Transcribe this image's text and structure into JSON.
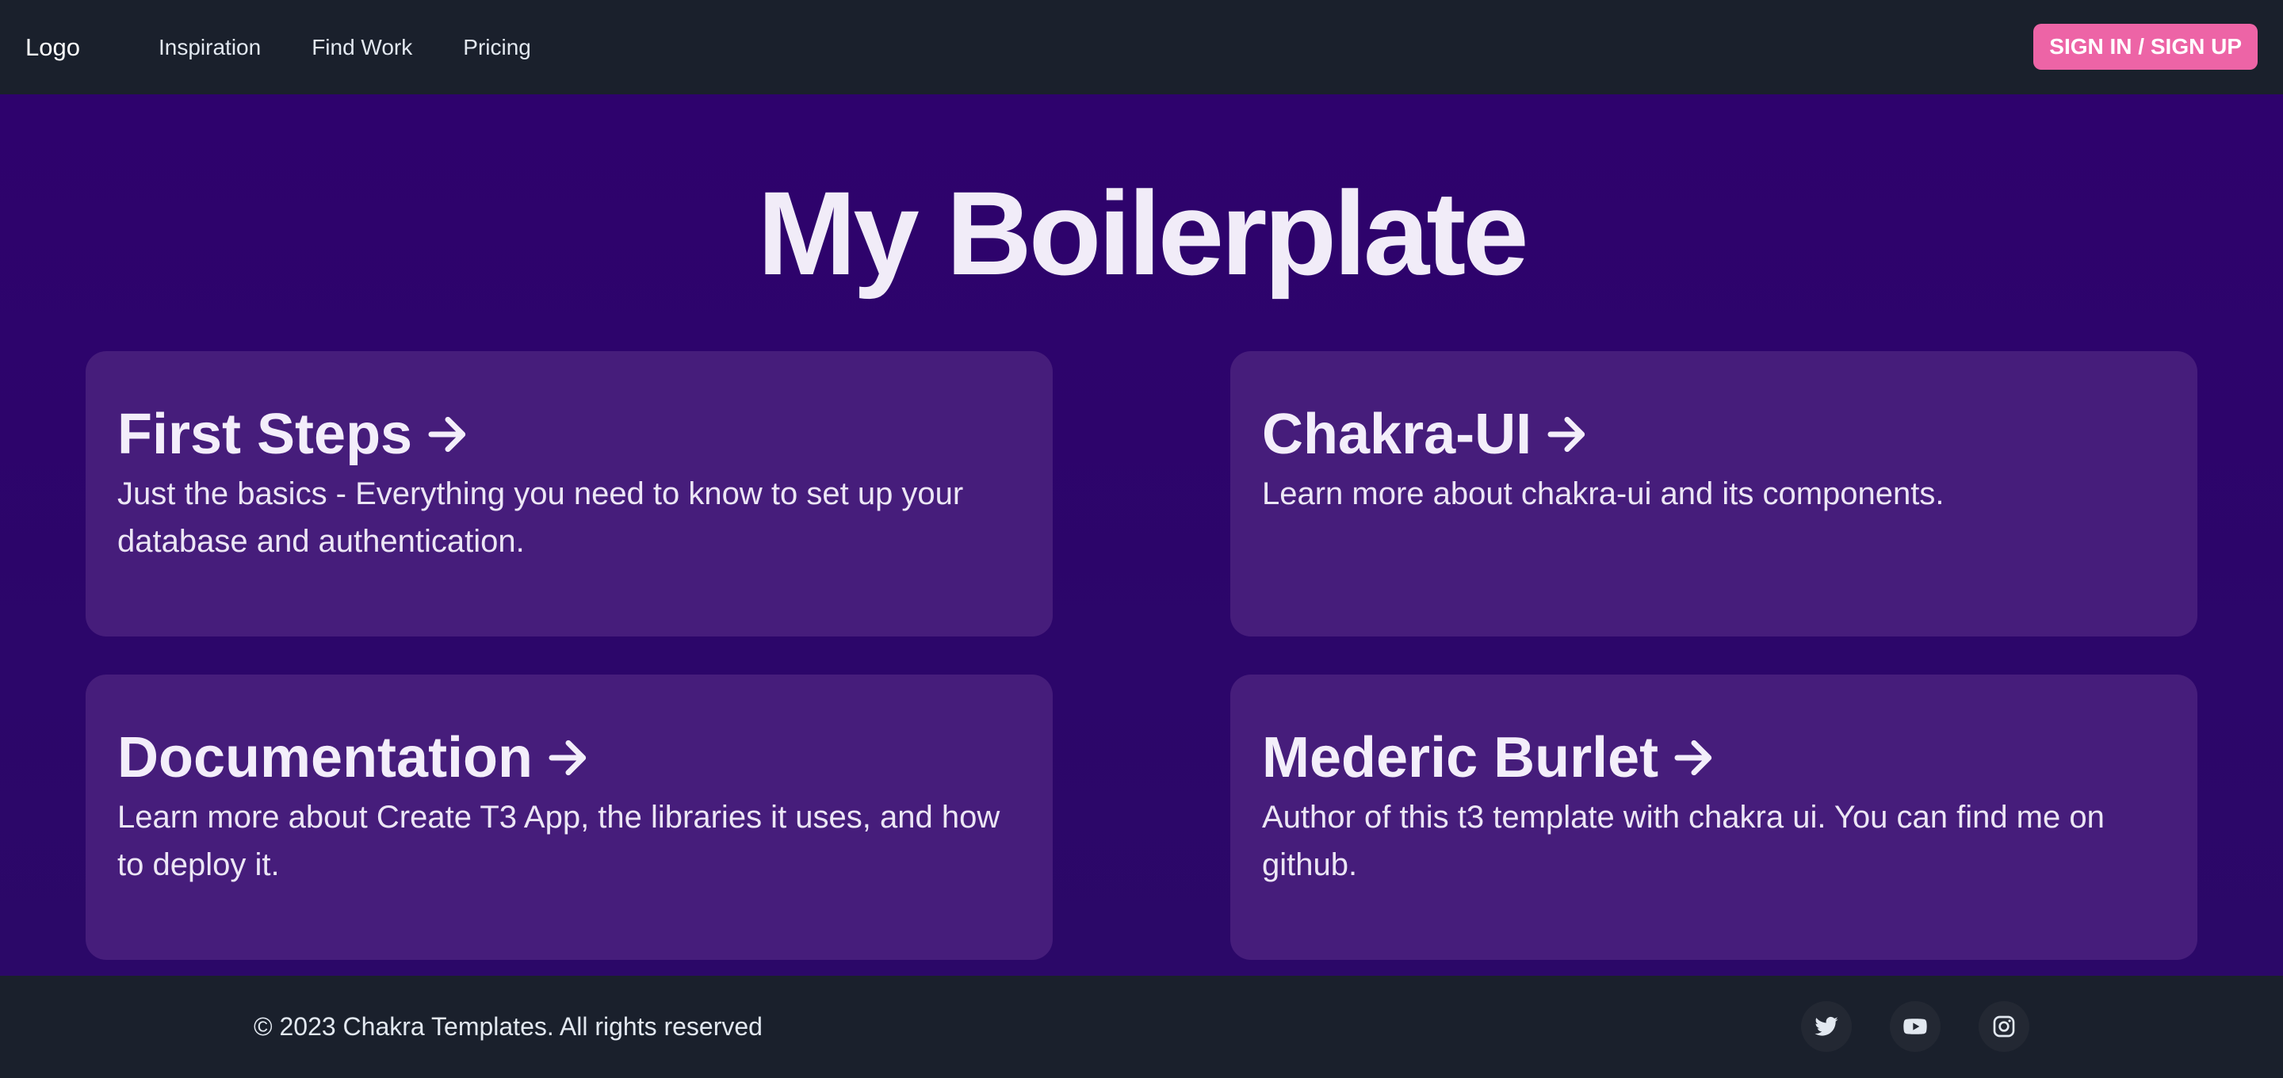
{
  "navbar": {
    "logo": "Logo",
    "links": [
      "Inspiration",
      "Find Work",
      "Pricing"
    ],
    "signin_label": "SIGN IN / SIGN UP"
  },
  "hero": {
    "title": "My Boilerplate"
  },
  "cards": [
    {
      "title": "First Steps",
      "description": "Just the basics - Everything you need to know to set up your database and authentication."
    },
    {
      "title": "Chakra-UI",
      "description": "Learn more about chakra-ui and its components."
    },
    {
      "title": "Documentation",
      "description": "Learn more about Create T3 App, the libraries it uses, and how to deploy it."
    },
    {
      "title": "Mederic Burlet",
      "description": "Author of this t3 template with chakra ui. You can find me on github."
    }
  ],
  "footer": {
    "copyright": "© 2023 Chakra Templates. All rights reserved",
    "social": [
      "twitter-icon",
      "youtube-icon",
      "instagram-icon"
    ]
  },
  "colors": {
    "nav_bg": "#1a202c",
    "page_bg": "#2e026d",
    "card_bg": "#461d7b",
    "accent": "#ed64a6"
  }
}
